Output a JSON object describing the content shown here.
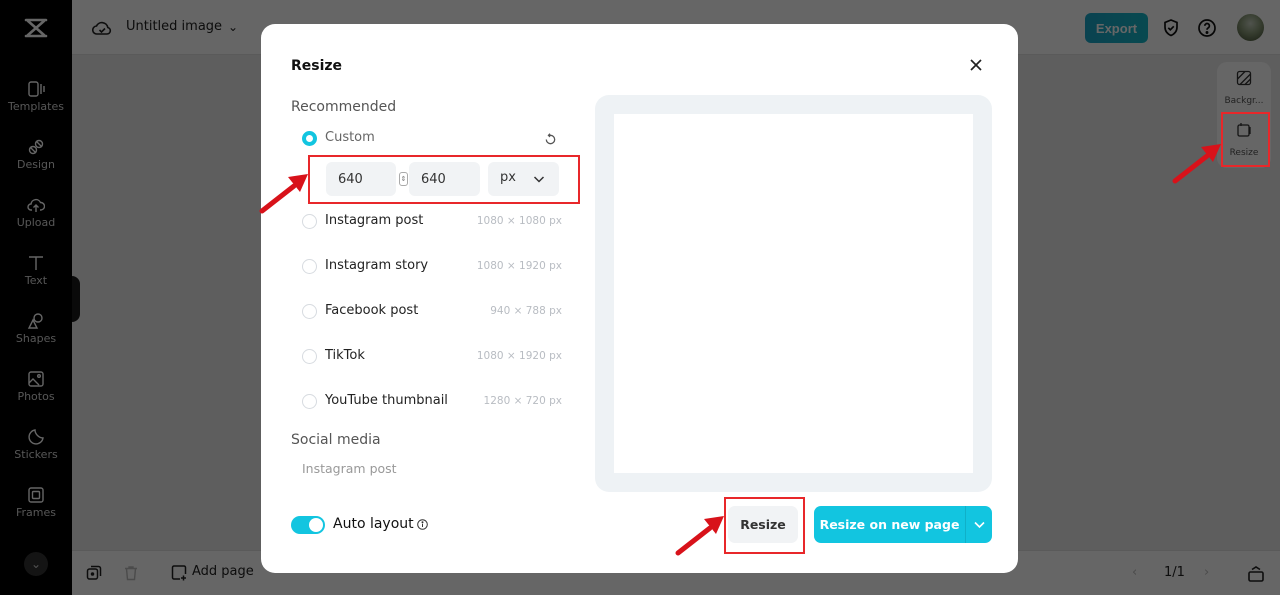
{
  "rail": {
    "logo": "capcut-logo-icon",
    "items": [
      {
        "label": "Templates",
        "icon": "templates-icon"
      },
      {
        "label": "Design",
        "icon": "design-icon"
      },
      {
        "label": "Upload",
        "icon": "upload-icon"
      },
      {
        "label": "Text",
        "icon": "text-icon"
      },
      {
        "label": "Shapes",
        "icon": "shapes-icon"
      },
      {
        "label": "Photos",
        "icon": "photos-icon"
      },
      {
        "label": "Stickers",
        "icon": "stickers-icon"
      },
      {
        "label": "Frames",
        "icon": "frames-icon"
      }
    ],
    "more_icon": "chevron-down-icon"
  },
  "topbar": {
    "title": "Untitled image",
    "export_label": "Export"
  },
  "side_tools": [
    {
      "label": "Backgr...",
      "icon": "background-icon"
    },
    {
      "label": "Resize",
      "icon": "resize-icon"
    }
  ],
  "bottombar": {
    "add_page_label": "Add page",
    "page_indicator": "1/1"
  },
  "modal": {
    "title": "Resize",
    "recommended_heading": "Recommended",
    "custom": {
      "label": "Custom",
      "selected": true,
      "width": "640",
      "height": "640",
      "unit": "px"
    },
    "presets": [
      {
        "label": "Instagram post",
        "size": "1080 × 1080 px"
      },
      {
        "label": "Instagram story",
        "size": "1080 × 1920 px"
      },
      {
        "label": "Facebook post",
        "size": "940 × 788 px"
      },
      {
        "label": "TikTok",
        "size": "1080 × 1920 px"
      },
      {
        "label": "YouTube thumbnail",
        "size": "1280 × 720 px"
      }
    ],
    "social_heading": "Social media",
    "social_items": [
      "Instagram post"
    ],
    "auto_layout_label": "Auto layout",
    "auto_layout_on": true,
    "resize_label": "Resize",
    "resize_new_label": "Resize on new page"
  },
  "colors": {
    "accent": "#12c5e0",
    "annotation": "#e8272a"
  }
}
